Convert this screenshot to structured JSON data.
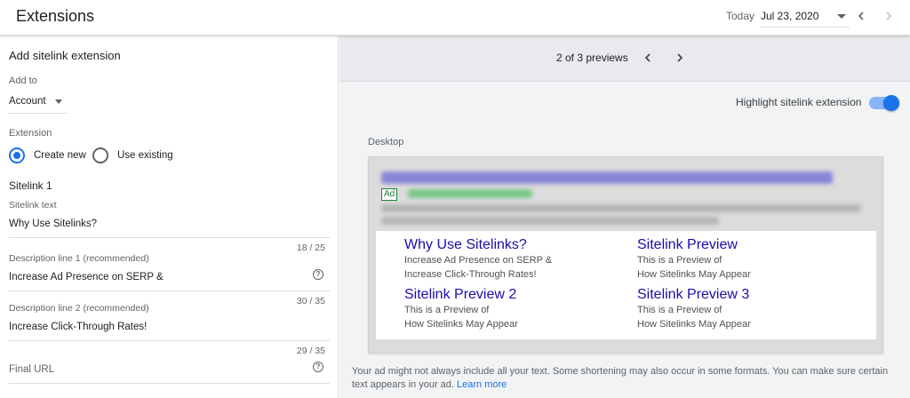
{
  "topbar": {
    "title": "Extensions",
    "today_label": "Today",
    "date_value": "Jul 23, 2020"
  },
  "form": {
    "title": "Add sitelink extension",
    "add_to_label": "Add to",
    "add_to_value": "Account",
    "extension_label": "Extension",
    "option_create": "Create new",
    "option_existing": "Use existing",
    "sitelink_heading": "Sitelink 1",
    "sitelink_text_label": "Sitelink text",
    "sitelink_text_value": "Why Use Sitelinks?",
    "sitelink_text_count": "18 / 25",
    "desc1_label": "Description line 1 (recommended)",
    "desc1_value": "Increase Ad Presence on SERP &",
    "desc1_count": "30 / 35",
    "desc2_label": "Description line 2 (recommended)",
    "desc2_value": "Increase Click-Through Rates!",
    "desc2_count": "29 / 35",
    "final_url_label": "Final URL"
  },
  "preview": {
    "counter": "2 of 3 previews",
    "highlight_label": "Highlight sitelink extension",
    "highlight_on": true,
    "device_label": "Desktop",
    "ad_badge": "Ad",
    "sitelinks": [
      {
        "title": "Why Use Sitelinks?",
        "line1": "Increase Ad Presence on SERP &",
        "line2": "Increase Click-Through Rates!"
      },
      {
        "title": "Sitelink Preview",
        "line1": "This is a Preview of",
        "line2": "How Sitelinks May Appear"
      },
      {
        "title": "Sitelink Preview 2",
        "line1": "This is a Preview of",
        "line2": "How Sitelinks May Appear"
      },
      {
        "title": "Sitelink Preview 3",
        "line1": "This is a Preview of",
        "line2": "How Sitelinks May Appear"
      }
    ],
    "note_text": "Your ad might not always include all your text. Some shortening may also occur in some formats. You can make sure certain text appears in your ad.",
    "learn_more": "Learn more"
  },
  "colors": {
    "accent": "#1a73e8",
    "link": "#1a0dab",
    "ad_green": "#188038"
  }
}
